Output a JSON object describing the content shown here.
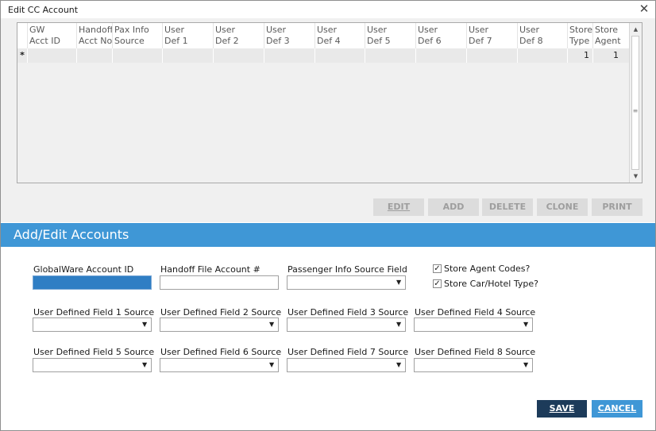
{
  "window": {
    "title": "Edit CC Account",
    "close_glyph": "✕"
  },
  "grid": {
    "columns": [
      {
        "line1": "GW",
        "line2": "Acct ID"
      },
      {
        "line1": "Handoff",
        "line2": "Acct No"
      },
      {
        "line1": "Pax Info",
        "line2": "Source"
      },
      {
        "line1": "User",
        "line2": "Def 1"
      },
      {
        "line1": "User",
        "line2": "Def 2"
      },
      {
        "line1": "User",
        "line2": "Def 3"
      },
      {
        "line1": "User",
        "line2": "Def 4"
      },
      {
        "line1": "User",
        "line2": "Def 5"
      },
      {
        "line1": "User",
        "line2": "Def 6"
      },
      {
        "line1": "User",
        "line2": "Def 7"
      },
      {
        "line1": "User",
        "line2": "Def 8"
      },
      {
        "line1": "Store",
        "line2": "Type"
      },
      {
        "line1": "Store",
        "line2": "Agent"
      }
    ],
    "new_row": {
      "indicator": "*",
      "store_type": "1",
      "store_agent": "1"
    },
    "scrollbar": {
      "up_icon": "▲",
      "down_icon": "▼",
      "grip_icon": "≡"
    }
  },
  "toolbar": {
    "edit_label": "EDIT",
    "add_label": "ADD",
    "delete_label": "DELETE",
    "clone_label": "CLONE",
    "print_label": "PRINT"
  },
  "section": {
    "title": "Add/Edit Accounts"
  },
  "form": {
    "globalware_account_id_label": "GlobalWare Account ID",
    "globalware_account_id_value": "",
    "handoff_file_account_label": "Handoff File Account #",
    "handoff_file_account_value": "",
    "passenger_info_source_label": "Passenger Info Source Field",
    "passenger_info_source_value": "",
    "store_agent_codes_label": "Store Agent Codes?",
    "store_agent_codes_checked": true,
    "store_car_hotel_type_label": "Store Car/Hotel Type?",
    "store_car_hotel_type_checked": true,
    "check_glyph": "✓",
    "dropdown_arrow": "▼",
    "user_fields": [
      {
        "label": "User Defined Field 1 Source",
        "value": ""
      },
      {
        "label": "User Defined Field 2 Source",
        "value": ""
      },
      {
        "label": "User Defined Field 3 Source",
        "value": ""
      },
      {
        "label": "User Defined Field 4 Source",
        "value": ""
      },
      {
        "label": "User Defined Field 5 Source",
        "value": ""
      },
      {
        "label": "User Defined Field 6 Source",
        "value": ""
      },
      {
        "label": "User Defined Field 7 Source",
        "value": ""
      },
      {
        "label": "User Defined Field 8 Source",
        "value": ""
      }
    ]
  },
  "footer": {
    "save_label": "SAVE",
    "cancel_label": "CANCEL"
  },
  "colors": {
    "section_header": "#3f97d6",
    "save_button": "#1d3b5a",
    "cancel_button": "#3f97d6",
    "focused_input": "#2f7ec4"
  }
}
